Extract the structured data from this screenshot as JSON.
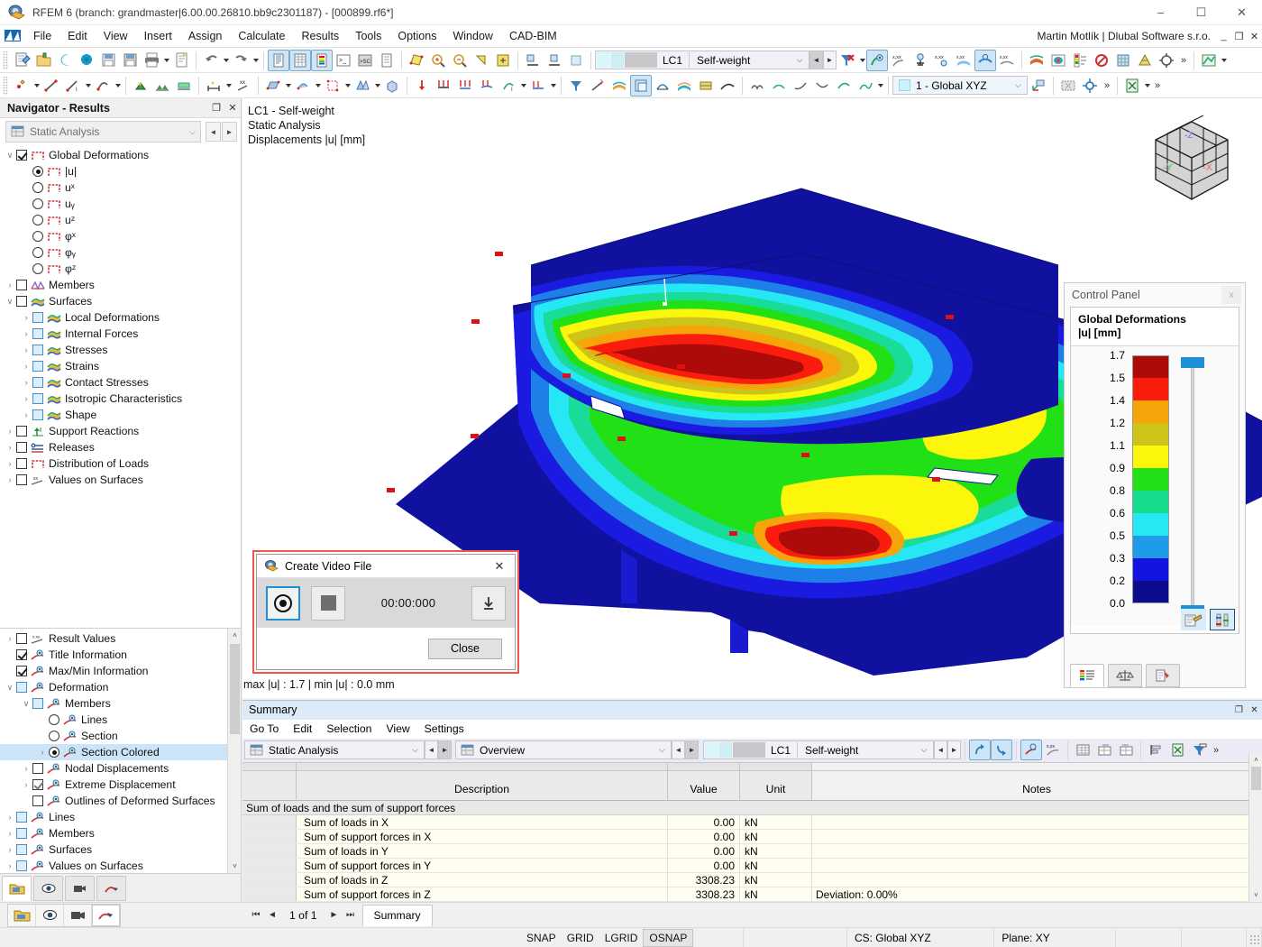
{
  "window": {
    "title": "RFEM 6 (branch: grandmaster|6.00.00.26810.bb9c2301187) - [000899.rf6*]",
    "app_icon": "rfem-icon",
    "minimize": "–",
    "maximize": "☐",
    "close": "✕"
  },
  "menu": {
    "items": [
      {
        "label": "File"
      },
      {
        "label": "Edit"
      },
      {
        "label": "View"
      },
      {
        "label": "Insert"
      },
      {
        "label": "Assign"
      },
      {
        "label": "Calculate"
      },
      {
        "label": "Results"
      },
      {
        "label": "Tools"
      },
      {
        "label": "Options"
      },
      {
        "label": "Window"
      },
      {
        "label": "CAD-BIM"
      }
    ],
    "user": "Martin Motlík | Dlubal Software s.r.o.",
    "mdi_minimize": "_",
    "mdi_restore": "❐",
    "mdi_close": "✕"
  },
  "toolbar": {
    "load_case": {
      "id": "LC1",
      "name": "Self-weight",
      "dropdown_arrow": "⌵",
      "prev": "◄",
      "next": "►"
    },
    "coord_system": {
      "value": "1 - Global XYZ",
      "dropdown_arrow": "⌵"
    },
    "overflow": "»"
  },
  "navigator": {
    "title": "Navigator - Results",
    "undock": "❐",
    "close": "✕",
    "analysis_combo": {
      "value": "Static Analysis",
      "icon": "table-icon",
      "dropdown_arrow": "⌵",
      "prev": "◄",
      "next": "►"
    },
    "top_tree": [
      {
        "label": "Global Deformations",
        "indent": 0,
        "control": "checkbox-checked",
        "expander": "∨",
        "icon": "frame-icon"
      },
      {
        "label": "|u|",
        "indent": 1,
        "control": "radio-on",
        "expander": "",
        "icon": "frame-icon"
      },
      {
        "label": "uˣ",
        "indent": 1,
        "control": "radio",
        "expander": "",
        "icon": "frame-icon"
      },
      {
        "label": "uᵧ",
        "indent": 1,
        "control": "radio",
        "expander": "",
        "icon": "frame-icon"
      },
      {
        "label": "uᶻ",
        "indent": 1,
        "control": "radio",
        "expander": "",
        "icon": "frame-icon"
      },
      {
        "label": "φˣ",
        "indent": 1,
        "control": "radio",
        "expander": "",
        "icon": "frame-icon"
      },
      {
        "label": "φᵧ",
        "indent": 1,
        "control": "radio",
        "expander": "",
        "icon": "frame-icon"
      },
      {
        "label": "φᶻ",
        "indent": 1,
        "control": "radio",
        "expander": "",
        "icon": "frame-icon"
      },
      {
        "label": "Members",
        "indent": 0,
        "control": "checkbox",
        "expander": "›",
        "icon": "members-icon"
      },
      {
        "label": "Surfaces",
        "indent": 0,
        "control": "checkbox",
        "expander": "∨",
        "icon": "surface-icon"
      },
      {
        "label": "Local Deformations",
        "indent": 1,
        "control": "checkbox-blue",
        "expander": "›",
        "icon": "surface-icon"
      },
      {
        "label": "Internal Forces",
        "indent": 1,
        "control": "checkbox-blue",
        "expander": "›",
        "icon": "surface-icon"
      },
      {
        "label": "Stresses",
        "indent": 1,
        "control": "checkbox-blue",
        "expander": "›",
        "icon": "surface-icon"
      },
      {
        "label": "Strains",
        "indent": 1,
        "control": "checkbox-blue",
        "expander": "›",
        "icon": "surface-icon"
      },
      {
        "label": "Contact Stresses",
        "indent": 1,
        "control": "checkbox-blue",
        "expander": "›",
        "icon": "surface-icon"
      },
      {
        "label": "Isotropic Characteristics",
        "indent": 1,
        "control": "checkbox-blue",
        "expander": "›",
        "icon": "surface-icon"
      },
      {
        "label": "Shape",
        "indent": 1,
        "control": "checkbox-blue",
        "expander": "›",
        "icon": "surface-icon"
      },
      {
        "label": "Support Reactions",
        "indent": 0,
        "control": "checkbox",
        "expander": "›",
        "icon": "support-icon"
      },
      {
        "label": "Releases",
        "indent": 0,
        "control": "checkbox",
        "expander": "›",
        "icon": "release-icon"
      },
      {
        "label": "Distribution of Loads",
        "indent": 0,
        "control": "checkbox",
        "expander": "›",
        "icon": "frame-icon"
      },
      {
        "label": "Values on Surfaces",
        "indent": 0,
        "control": "checkbox",
        "expander": "›",
        "icon": "xx-icon"
      }
    ],
    "bottom_tree": [
      {
        "label": "Result Values",
        "indent": 0,
        "control": "checkbox",
        "expander": "›",
        "icon": "xxx-icon",
        "selected": false
      },
      {
        "label": "Title Information",
        "indent": 0,
        "control": "checkbox-checked",
        "expander": "",
        "icon": "display-icon",
        "selected": false
      },
      {
        "label": "Max/Min Information",
        "indent": 0,
        "control": "checkbox-checked",
        "expander": "",
        "icon": "display-icon",
        "selected": false
      },
      {
        "label": "Deformation",
        "indent": 0,
        "control": "checkbox-blue",
        "expander": "∨",
        "icon": "display-icon",
        "selected": false
      },
      {
        "label": "Members",
        "indent": 1,
        "control": "checkbox-blue",
        "expander": "∨",
        "icon": "display-icon",
        "selected": false
      },
      {
        "label": "Lines",
        "indent": 2,
        "control": "radio",
        "expander": "",
        "icon": "display-icon",
        "selected": false
      },
      {
        "label": "Section",
        "indent": 2,
        "control": "radio",
        "expander": "",
        "icon": "display-icon",
        "selected": false
      },
      {
        "label": "Section Colored",
        "indent": 2,
        "control": "radio-on",
        "expander": "›",
        "icon": "display-icon",
        "selected": true
      },
      {
        "label": "Nodal Displacements",
        "indent": 1,
        "control": "checkbox",
        "expander": "›",
        "icon": "display-icon",
        "selected": false
      },
      {
        "label": "Extreme Displacement",
        "indent": 1,
        "control": "checkbox-checked-grey",
        "expander": "›",
        "icon": "display-icon",
        "selected": false
      },
      {
        "label": "Outlines of Deformed Surfaces",
        "indent": 1,
        "control": "checkbox",
        "expander": "",
        "icon": "display-icon",
        "selected": false
      },
      {
        "label": "Lines",
        "indent": 0,
        "control": "checkbox-blue",
        "expander": "›",
        "icon": "display-icon",
        "selected": false
      },
      {
        "label": "Members",
        "indent": 0,
        "control": "checkbox-blue",
        "expander": "›",
        "icon": "display-icon",
        "selected": false
      },
      {
        "label": "Surfaces",
        "indent": 0,
        "control": "checkbox-blue",
        "expander": "›",
        "icon": "display-icon",
        "selected": false
      },
      {
        "label": "Values on Surfaces",
        "indent": 0,
        "control": "checkbox-blue",
        "expander": "›",
        "icon": "display-icon",
        "selected": false
      }
    ],
    "scroll_up": "˄",
    "scroll_down": "˅",
    "tabs": [
      {
        "name": "tab-project-navigator",
        "icon": "project-icon",
        "active": true
      },
      {
        "name": "tab-view-navigator",
        "icon": "eye-icon",
        "active": false
      },
      {
        "name": "tab-video-navigator",
        "icon": "camera-icon",
        "active": false
      },
      {
        "name": "tab-results-navigator",
        "icon": "results-icon",
        "active": false
      }
    ]
  },
  "viewport": {
    "title_line1": "LC1 - Self-weight",
    "title_line2": "Static Analysis",
    "title_line3": "Displacements |u| [mm]",
    "maxmin": "max |u| : 1.7 | min |u| : 0.0 mm",
    "navicube_labels": {
      "x": "-X",
      "y": "-Y",
      "z": "-Z"
    }
  },
  "control_panel": {
    "title": "Control Panel",
    "close": "x",
    "subtitle_line1": "Global Deformations",
    "subtitle_line2": "|u| [mm]",
    "legend_values": [
      "1.7",
      "1.5",
      "1.4",
      "1.2",
      "1.1",
      "0.9",
      "0.8",
      "0.6",
      "0.5",
      "0.3",
      "0.2",
      "0.0"
    ],
    "legend_colors": [
      "#ad0a0a",
      "#fa1c0c",
      "#f7a30a",
      "#ccc419",
      "#fbf60b",
      "#22e016",
      "#15dc8a",
      "#26e8f5",
      "#1e9ce8",
      "#1414e0",
      "#0c0c8c"
    ],
    "bottom_buttons": [
      {
        "name": "color-edit-button",
        "icon": "palette-icon",
        "selected": false
      },
      {
        "name": "scale-values-button",
        "icon": "sliders-icon",
        "selected": true
      }
    ],
    "tabs": [
      {
        "name": "cp-tab-colors",
        "icon": "color-scale-icon",
        "active": true
      },
      {
        "name": "cp-tab-factors",
        "icon": "scales-icon",
        "active": false
      },
      {
        "name": "cp-tab-filter",
        "icon": "filter-icon",
        "active": false
      }
    ]
  },
  "video_dialog": {
    "title": "Create Video File",
    "icon": "rfem-icon",
    "close": "✕",
    "record_button": "record-button",
    "stop_button": "stop-button",
    "timer": "00:00:000",
    "save_button": "save-button",
    "save_glyph": "⤓",
    "close_label": "Close"
  },
  "summary": {
    "title": "Summary",
    "undock": "❐",
    "close": "✕",
    "menu": [
      "Go To",
      "Edit",
      "Selection",
      "View",
      "Settings"
    ],
    "analysis_combo": {
      "value": "Static Analysis",
      "dropdown_arrow": "⌵"
    },
    "view_combo": {
      "value": "Overview",
      "dropdown_arrow": "⌵"
    },
    "load_case": {
      "id": "LC1",
      "name": "Self-weight",
      "dropdown_arrow": "⌵"
    },
    "prev": "◄",
    "next": "►",
    "overflow": "»",
    "columns": [
      "",
      "Description",
      "Value",
      "Unit",
      "Notes"
    ],
    "section_title": "Sum of loads and the sum of support forces",
    "rows": [
      {
        "description": "Sum of loads in X",
        "value": "0.00",
        "unit": "kN",
        "notes": ""
      },
      {
        "description": "Sum of support forces in X",
        "value": "0.00",
        "unit": "kN",
        "notes": ""
      },
      {
        "description": "Sum of loads in Y",
        "value": "0.00",
        "unit": "kN",
        "notes": ""
      },
      {
        "description": "Sum of support forces in Y",
        "value": "0.00",
        "unit": "kN",
        "notes": ""
      },
      {
        "description": "Sum of loads in Z",
        "value": "3308.23",
        "unit": "kN",
        "notes": ""
      },
      {
        "description": "Sum of support forces in Z",
        "value": "3308.23",
        "unit": "kN",
        "notes": "Deviation: 0.00%"
      }
    ],
    "scroll_up": "˄",
    "scroll_down": "˅"
  },
  "pager": {
    "first": "⏮",
    "prev": "◄",
    "text": "1 of 1",
    "next": "►",
    "last": "⏭",
    "tab": "Summary"
  },
  "statusbar": {
    "snap_buttons": [
      {
        "label": "SNAP",
        "active": false
      },
      {
        "label": "GRID",
        "active": false
      },
      {
        "label": "LGRID",
        "active": false
      },
      {
        "label": "OSNAP",
        "active": true
      }
    ],
    "cs": "CS: Global XYZ",
    "plane": "Plane: XY"
  },
  "colors": {
    "accent": "#1e90d8",
    "highlight": "#cce4f7",
    "dialog_border": "#f4554a",
    "summary_header": "#dbeaf6"
  }
}
